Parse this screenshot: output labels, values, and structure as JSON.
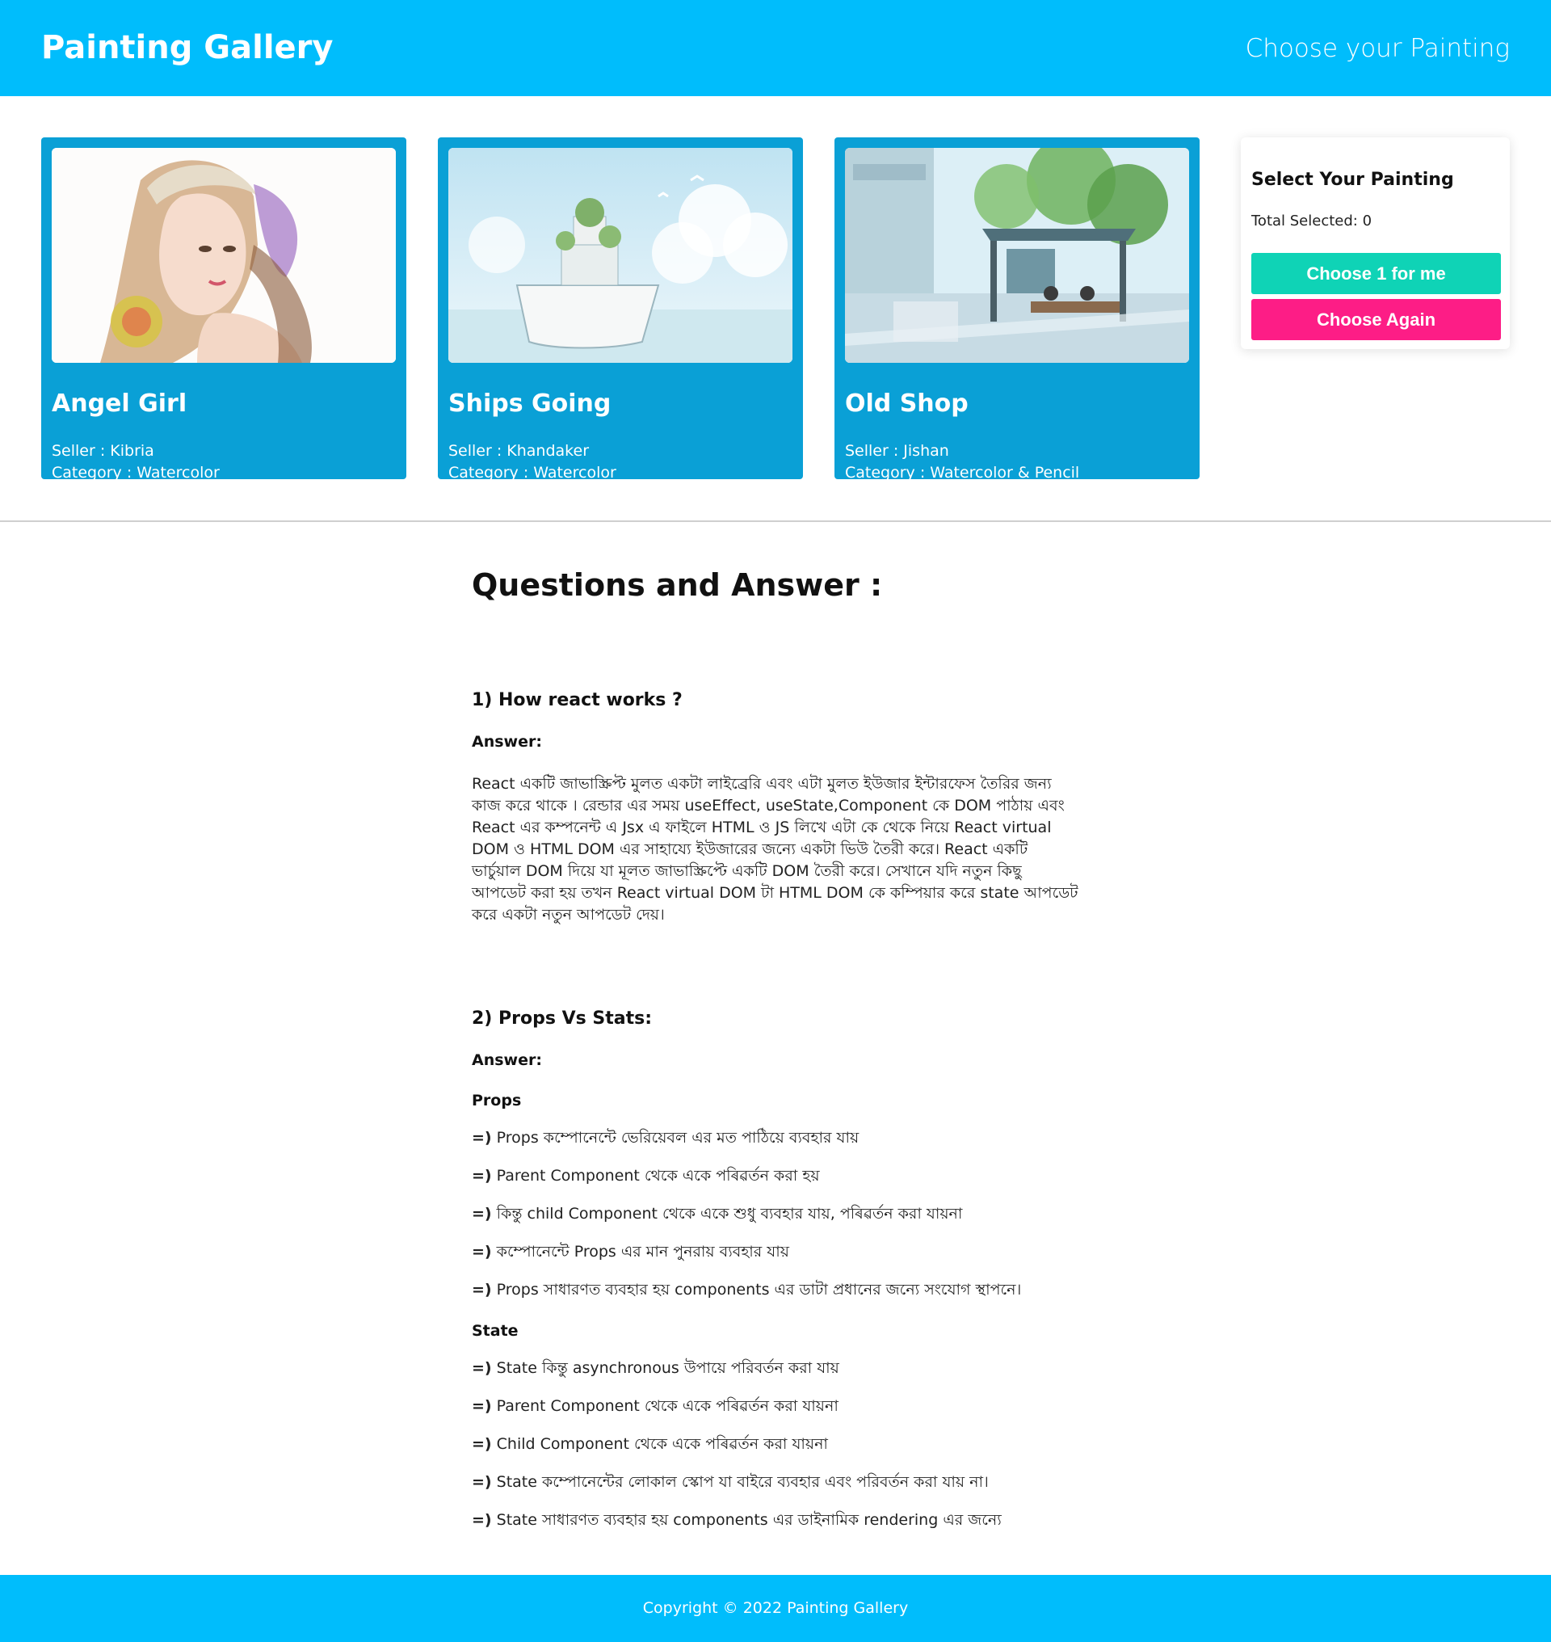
{
  "header": {
    "brand": "Painting Gallery",
    "tagline": "Choose your Painting"
  },
  "paintings": [
    {
      "name": "Angel Girl",
      "seller": "Seller : Kibria",
      "category": "Category : Watercolor"
    },
    {
      "name": "Ships Going",
      "seller": "Seller : Khandaker",
      "category": "Category : Watercolor"
    },
    {
      "name": "Old Shop",
      "seller": "Seller : Jishan",
      "category": "Category : Watercolor & Pencil"
    }
  ],
  "panel": {
    "title": "Select Your Painting",
    "total": "Total Selected: 0",
    "choose_label": "Choose 1 for me",
    "again_label": "Choose Again"
  },
  "qa": {
    "title": "Questions and Answer :",
    "q1": {
      "question": "1) How react works ?",
      "answer_label": "Answer:",
      "text": "React একটি জাভাস্ক্রিপ্ট মুলত একটা লাইব্রেরি এবং এটা মুলত ইউজার ইন্টারফেস তৈরির জন্য কাজ করে থাকে । রেন্ডার এর সময় useEffect, useState,Component কে DOM পাঠায় এবং React এর কম্পনেন্ট এ Jsx এ ফাইলে HTML ও JS লিখে এটা কে থেকে নিয়ে React virtual DOM ও HTML DOM এর সাহায্যে ইউজারের জন্যে একটা ভিউ তৈরী করে। React একটি ভার্চুয়াল DOM দিয়ে যা মূলত জাভাস্ক্রিপ্টে একটি DOM তৈরী করে। সেখানে যদি নতুন কিছু আপডেট করা হয় তখন React virtual DOM টা HTML DOM কে কম্পিয়ার করে state আপডেট করে একটা নতুন আপডেট দেয়।"
    },
    "q2": {
      "question": "2) Props Vs Stats:",
      "answer_label": "Answer:",
      "props_heading": "Props",
      "props": [
        "Props কম্পোনেন্টে ভেরিয়েবল এর মত পাঠিয়ে ব্যবহার যায়",
        "Parent Component থেকে একে পৰিৱৰ্তন করা হয়",
        "কিন্তু child Component থেকে একে শুধু ব্যবহার যায়, পৰিৱৰ্তন করা যায়না",
        "কম্পোনেন্টে Props এর মান পুনরায় ব্যবহার যায়",
        "Props সাধারণত ব্যবহার হয় components এর ডাটা প্রধানের জন্যে সংযোগ স্থাপনে।"
      ],
      "state_heading": "State",
      "state": [
        "State কিন্তু asynchronous উপায়ে পরিবর্তন করা যায়",
        "Parent Component থেকে একে পৰিৱৰ্তন করা যায়না",
        "Child Component থেকে একে পৰিৱৰ্তন করা যায়না",
        "State কম্পোনেন্টের লোকাল স্কোপ যা বাইরে ব্যবহার এবং পরিবর্তন করা যায় না।",
        "State সাধারণত ব্যবহার হয় components এর ডাইনামিক rendering এর জন্যে"
      ],
      "bullet": "=)"
    }
  },
  "footer": {
    "copyright": "Copyright © 2022 Painting Gallery"
  },
  "colors": {
    "header": "#00bdfc",
    "card": "#0aa0d6",
    "choose": "#0fd3b6",
    "again": "#fd1d86"
  }
}
